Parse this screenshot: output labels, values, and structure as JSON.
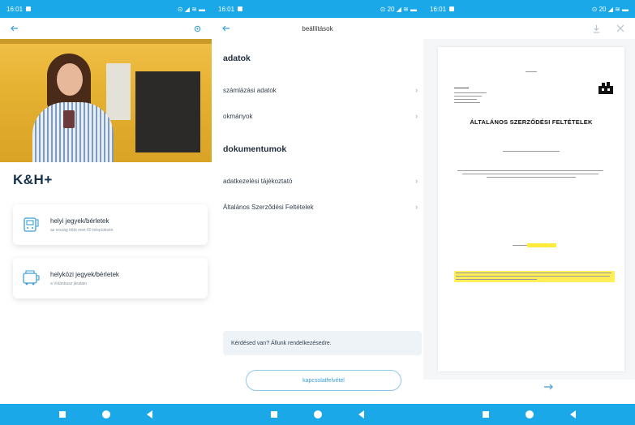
{
  "status_bars": [
    {
      "time": "16:01",
      "indicators": "⊙ ◢ ≋ ▬"
    },
    {
      "time": "16:01",
      "indicators": "⊙ 20 ◢ ≋ ▬"
    },
    {
      "time": "16:01",
      "indicators": "⊙ 20 ◢ ≋ ▬"
    }
  ],
  "screen1": {
    "brand": "K&H+",
    "cards": [
      {
        "title": "helyi jegyek/bérletek",
        "subtitle": "az ország több mint 60 településén"
      },
      {
        "title": "helyközi jegyek/bérletek",
        "subtitle": "a Volánbusz járatain"
      }
    ]
  },
  "screen2": {
    "title": "beállítások",
    "sections": [
      {
        "heading": "adatok",
        "items": [
          "számlázási adatok",
          "okmányok"
        ]
      },
      {
        "heading": "dokumentumok",
        "items": [
          "adatkezelési tájékoztató",
          "Általános Szerződési Feltételek"
        ]
      }
    ],
    "help_text": "Kérdésed van? Állunk rendelkezésedre.",
    "contact_button": "kapcsolatfelvétel"
  },
  "screen3": {
    "document_title": "ÁLTALÁNOS SZERZŐDÉSI FELTÉTELEK"
  },
  "colors": {
    "accent": "#1aa8e8",
    "link": "#3a9fd8",
    "highlight": "#ffeb3b"
  },
  "icons": {
    "back": "arrow-left-icon",
    "settings": "gear-icon",
    "download": "download-icon",
    "close": "close-icon",
    "next": "arrow-right-icon"
  }
}
